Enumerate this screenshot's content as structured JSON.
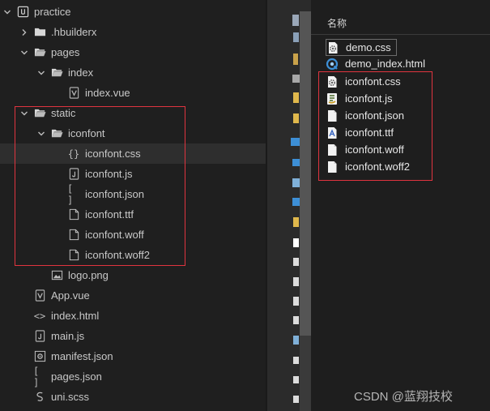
{
  "tree": {
    "items": [
      {
        "label": "practice",
        "indent": 0,
        "type": "project",
        "open": true
      },
      {
        "label": ".hbuilderx",
        "indent": 1,
        "type": "folder",
        "open": false
      },
      {
        "label": "pages",
        "indent": 1,
        "type": "folder",
        "open": true
      },
      {
        "label": "index",
        "indent": 2,
        "type": "folder",
        "open": true
      },
      {
        "label": "index.vue",
        "indent": 3,
        "type": "vue"
      },
      {
        "label": "static",
        "indent": 1,
        "type": "folder",
        "open": true
      },
      {
        "label": "iconfont",
        "indent": 2,
        "type": "folder",
        "open": true
      },
      {
        "label": "iconfont.css",
        "indent": 3,
        "type": "css",
        "selected": true
      },
      {
        "label": "iconfont.js",
        "indent": 3,
        "type": "js"
      },
      {
        "label": "iconfont.json",
        "indent": 3,
        "type": "json"
      },
      {
        "label": "iconfont.ttf",
        "indent": 3,
        "type": "file"
      },
      {
        "label": "iconfont.woff",
        "indent": 3,
        "type": "file"
      },
      {
        "label": "iconfont.woff2",
        "indent": 3,
        "type": "file"
      },
      {
        "label": "logo.png",
        "indent": 2,
        "type": "image"
      },
      {
        "label": "App.vue",
        "indent": 1,
        "type": "vue"
      },
      {
        "label": "index.html",
        "indent": 1,
        "type": "html"
      },
      {
        "label": "main.js",
        "indent": 1,
        "type": "js"
      },
      {
        "label": "manifest.json",
        "indent": 1,
        "type": "manifest"
      },
      {
        "label": "pages.json",
        "indent": 1,
        "type": "json"
      },
      {
        "label": "uni.scss",
        "indent": 1,
        "type": "scss"
      }
    ]
  },
  "explorer": {
    "column_header": "名称",
    "files": [
      {
        "label": "demo.css",
        "icon": "css-settings-icon",
        "boxed": true
      },
      {
        "label": "demo_index.html",
        "icon": "browser-icon"
      },
      {
        "label": "iconfont.css",
        "icon": "css-settings-icon"
      },
      {
        "label": "iconfont.js",
        "icon": "script-icon"
      },
      {
        "label": "iconfont.json",
        "icon": "blank-file-icon"
      },
      {
        "label": "iconfont.ttf",
        "icon": "font-file-icon"
      },
      {
        "label": "iconfont.woff",
        "icon": "blank-file-icon"
      },
      {
        "label": "iconfont.woff2",
        "icon": "blank-file-icon"
      }
    ]
  },
  "watermark": "CSDN @蓝翔技校",
  "colors": {
    "highlight_box": "#e0343f",
    "tree_bg": "#1f1f1f",
    "explorer_bg": "#1e1e1e",
    "folder_icon": "#d7d7d7"
  }
}
